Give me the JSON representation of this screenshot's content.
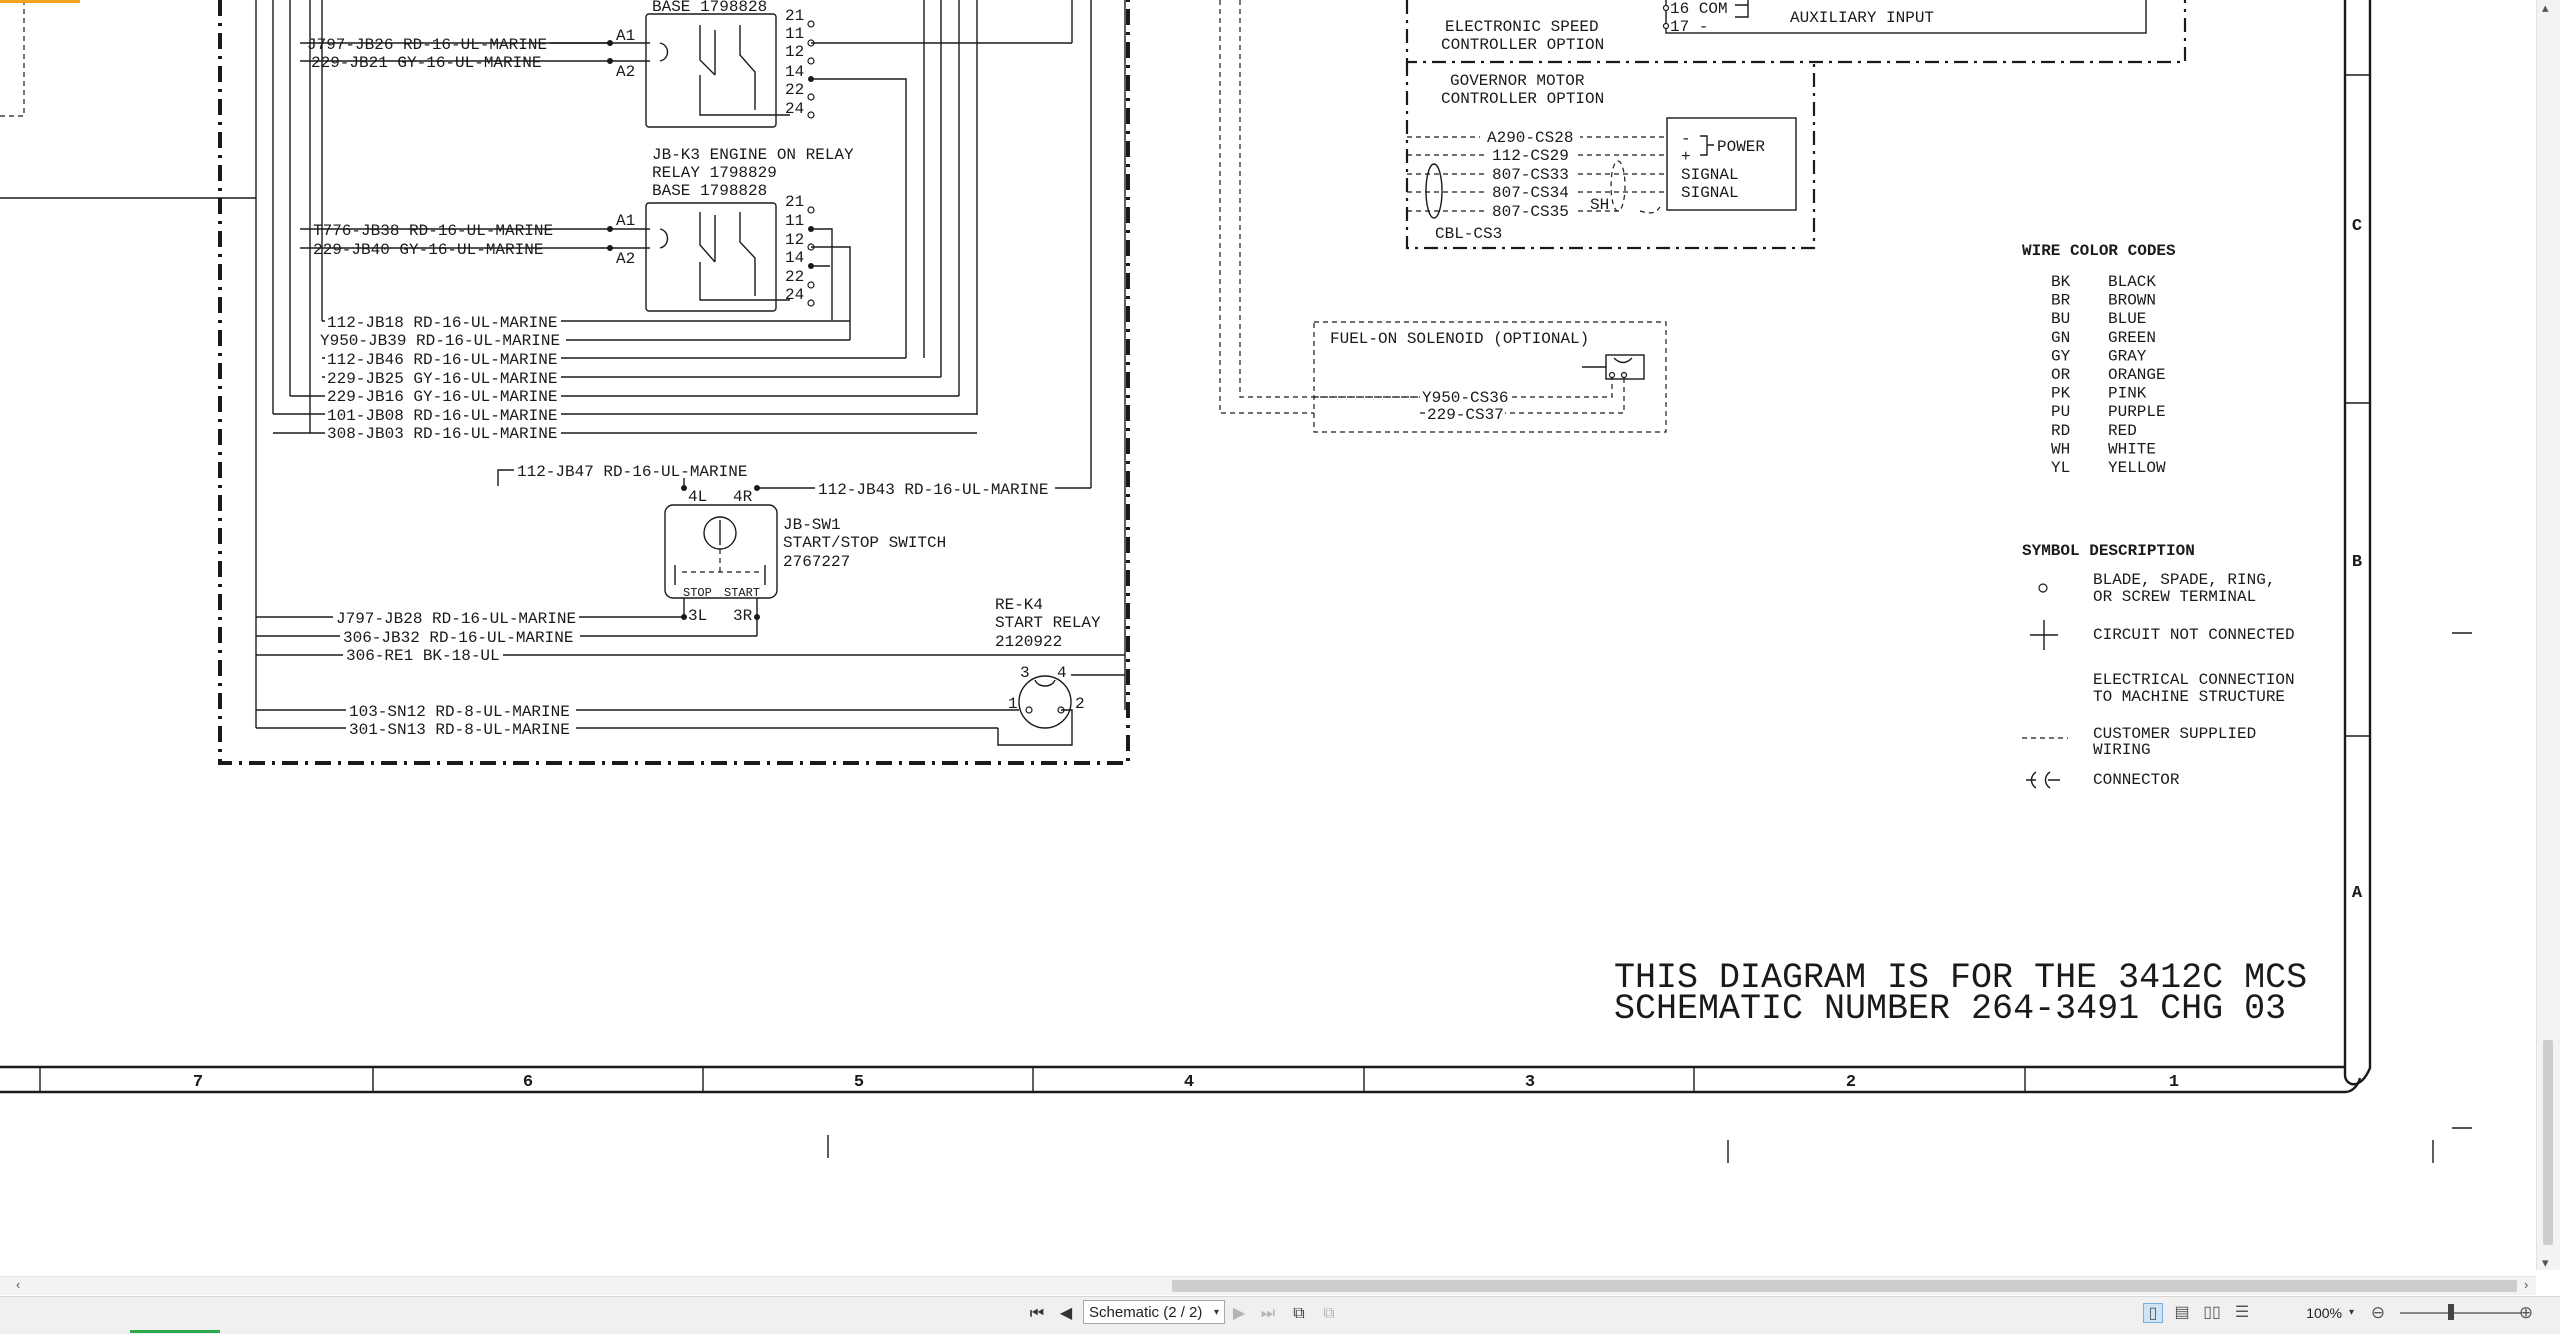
{
  "drawing": {
    "relay_k2": {
      "base": "BASE 1798828",
      "wires": [
        "J797-JB26 RD-16-UL-MARINE",
        "229-JB21 GY-16-UL-MARINE"
      ],
      "coil_pins": [
        "A1",
        "A2"
      ],
      "contacts": [
        "21",
        "11",
        "12",
        "14",
        "22",
        "24"
      ]
    },
    "relay_k3": {
      "title": "JB-K3   ENGINE ON RELAY",
      "relay": "RELAY 1798829",
      "base": "BASE 1798828",
      "wires": [
        "T776-JB38 RD-16-UL-MARINE",
        "229-JB40 GY-16-UL-MARINE"
      ],
      "coil_pins": [
        "A1",
        "A2"
      ],
      "contacts": [
        "21",
        "11",
        "12",
        "14",
        "22",
        "24"
      ]
    },
    "harness_wires": [
      "112-JB18 RD-16-UL-MARINE",
      "Y950-JB39 RD-16-UL-MARINE",
      "112-JB46 RD-16-UL-MARINE",
      "229-JB25 GY-16-UL-MARINE",
      "229-JB16 GY-16-UL-MARINE",
      "101-JB08 RD-16-UL-MARINE",
      "308-JB03 RD-16-UL-MARINE"
    ],
    "switch": {
      "wire_top_left": "112-JB47 RD-16-UL-MARINE",
      "wire_top_right": "112-JB43 RD-16-UL-MARINE",
      "pin_4l": "4L",
      "pin_4r": "4R",
      "pin_3l": "3L",
      "pin_3r": "3R",
      "name": "JB-SW1",
      "desc": "START/STOP SWITCH",
      "part": "2767227",
      "stop": "STOP",
      "start": "START",
      "wires_bottom": [
        "J797-JB28 RD-16-UL-MARINE",
        "306-JB32 RD-16-UL-MARINE",
        "306-RE1 BK-18-UL"
      ]
    },
    "start_relay": {
      "name": "RE-K4",
      "desc": "START RELAY",
      "part": "2120922",
      "pins": [
        "3",
        "4",
        "1",
        "2"
      ],
      "wires": [
        "103-SN12 RD-8-UL-MARINE",
        "301-SN13 RD-8-UL-MARINE"
      ]
    },
    "speed_controller": {
      "label1": "ELECTRONIC SPEED",
      "label2": "CONTROLLER OPTION",
      "term16": "16 COM",
      "term17": "17 -",
      "aux": "AUXILIARY INPUT"
    },
    "governor": {
      "label1": "GOVERNOR MOTOR",
      "label2": "CONTROLLER OPTION",
      "wires": [
        "A290-CS28",
        "112-CS29",
        "807-CS33",
        "807-CS34",
        "807-CS35"
      ],
      "pins": [
        "-",
        "+",
        "SIGNAL",
        "SIGNAL"
      ],
      "power": "POWER",
      "sh": "SH",
      "cable": "CBL-CS3"
    },
    "fuel_solenoid": {
      "label": "FUEL-ON SOLENOID (OPTIONAL)",
      "wires": [
        "Y950-CS36",
        "229-CS37"
      ]
    },
    "wire_color_codes": {
      "title": "WIRE COLOR CODES",
      "codes": [
        {
          "code": "BK",
          "name": "BLACK"
        },
        {
          "code": "BR",
          "name": "BROWN"
        },
        {
          "code": "BU",
          "name": "BLUE"
        },
        {
          "code": "GN",
          "name": "GREEN"
        },
        {
          "code": "GY",
          "name": "GRAY"
        },
        {
          "code": "OR",
          "name": "ORANGE"
        },
        {
          "code": "PK",
          "name": "PINK"
        },
        {
          "code": "PU",
          "name": "PURPLE"
        },
        {
          "code": "RD",
          "name": "RED"
        },
        {
          "code": "WH",
          "name": "WHITE"
        },
        {
          "code": "YL",
          "name": "YELLOW"
        }
      ]
    },
    "symbols": {
      "title": "SYMBOL  DESCRIPTION",
      "items": [
        {
          "line1": "BLADE, SPADE, RING,",
          "line2": "OR SCREW TERMINAL"
        },
        {
          "line1": "CIRCUIT NOT CONNECTED",
          "line2": ""
        },
        {
          "line1": "ELECTRICAL CONNECTION",
          "line2": "TO MACHINE STRUCTURE"
        },
        {
          "line1": "CUSTOMER SUPPLIED",
          "line2": "WIRING"
        },
        {
          "line1": "CONNECTOR",
          "line2": ""
        }
      ]
    },
    "note_line1": "THIS DIAGRAM IS FOR THE 3412C MCS",
    "note_line2": "SCHEMATIC NUMBER 264-3491 CHG 03",
    "columns": [
      "7",
      "6",
      "5",
      "4",
      "3",
      "2",
      "1"
    ],
    "rows": [
      "C",
      "B",
      "A"
    ]
  },
  "toolbar": {
    "page_select": "Schematic (2 / 2)",
    "zoom": "100%"
  },
  "colors": {
    "accent_top": "#f2a31a",
    "accent_bottom": "#2ba84a"
  }
}
